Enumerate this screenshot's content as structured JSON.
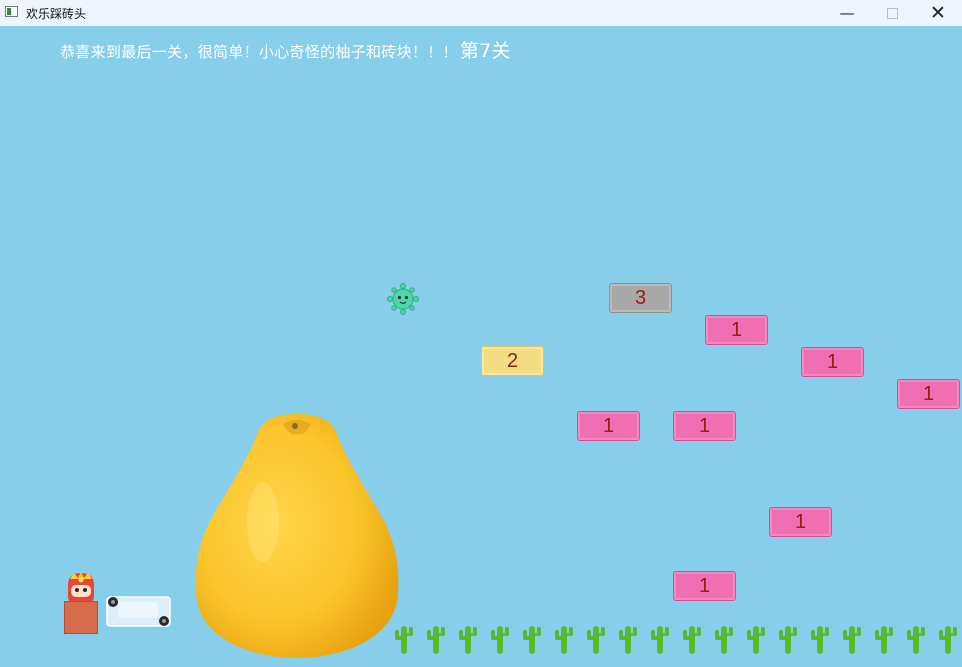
{
  "window": {
    "title": "欢乐踩砖头",
    "buttons": [
      "minimize",
      "maximize",
      "close"
    ]
  },
  "hud": {
    "message": "恭喜来到最后一关，很简单！小心奇怪的柚子和砖块！！！",
    "level": "第7关"
  },
  "bricks": [
    {
      "label": "3",
      "color": "gray"
    },
    {
      "label": "1",
      "color": "pink"
    },
    {
      "label": "2",
      "color": "yellow"
    },
    {
      "label": "1",
      "color": "pink"
    },
    {
      "label": "1",
      "color": "pink"
    },
    {
      "label": "1",
      "color": "pink"
    },
    {
      "label": "1",
      "color": "pink"
    },
    {
      "label": "1",
      "color": "pink"
    },
    {
      "label": "1",
      "color": "pink"
    }
  ],
  "colors": {
    "sky": "#87ceeb",
    "brick_pink": "#ef6fb2",
    "brick_yellow": "#f4dc82",
    "brick_gray": "#a9a9a9",
    "brick_text": "#9a1b1b"
  },
  "icons": {
    "minimize": "minimize-icon",
    "maximize": "maximize-icon",
    "close": "close-icon"
  }
}
